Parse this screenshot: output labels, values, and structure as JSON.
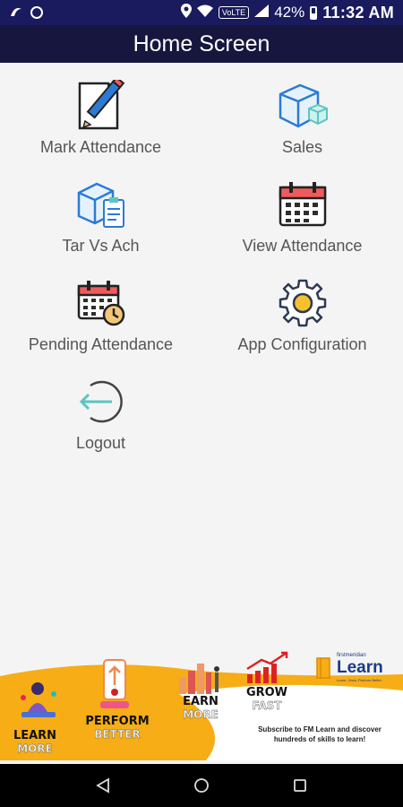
{
  "status_bar": {
    "network_badge": "VoLTE",
    "battery": "42%",
    "time": "11:32 AM"
  },
  "header": {
    "title": "Home Screen"
  },
  "menu": [
    {
      "label": "Mark Attendance",
      "icon": "pencil-paper-icon"
    },
    {
      "label": "Sales",
      "icon": "box-icon"
    },
    {
      "label": "Tar Vs Ach",
      "icon": "box-clipboard-icon"
    },
    {
      "label": "View Attendance",
      "icon": "calendar-icon"
    },
    {
      "label": "Pending Attendance",
      "icon": "calendar-clock-icon"
    },
    {
      "label": "App Configuration",
      "icon": "gear-icon"
    },
    {
      "label": "Logout",
      "icon": "logout-icon"
    }
  ],
  "banner": {
    "items": [
      {
        "main": "LEARN",
        "sub": "MORE"
      },
      {
        "main": "PERFORM",
        "sub": "BETTER"
      },
      {
        "main": "EARN",
        "sub": "MORE"
      },
      {
        "main": "GROW",
        "sub": "FAST"
      }
    ],
    "logo_small": "firstmeridian",
    "logo_text": "Learn",
    "logo_tagline": "Learn, Grow, Perform Better",
    "subscribe_text": "Subscribe to FM Learn and discover hundreds of skills to learn!"
  },
  "colors": {
    "status_bar": "#1a1a5e",
    "header": "#16163f",
    "banner": "#f7ad15",
    "icon_blue": "#2b7bd6",
    "icon_teal": "#5cc5c0"
  }
}
